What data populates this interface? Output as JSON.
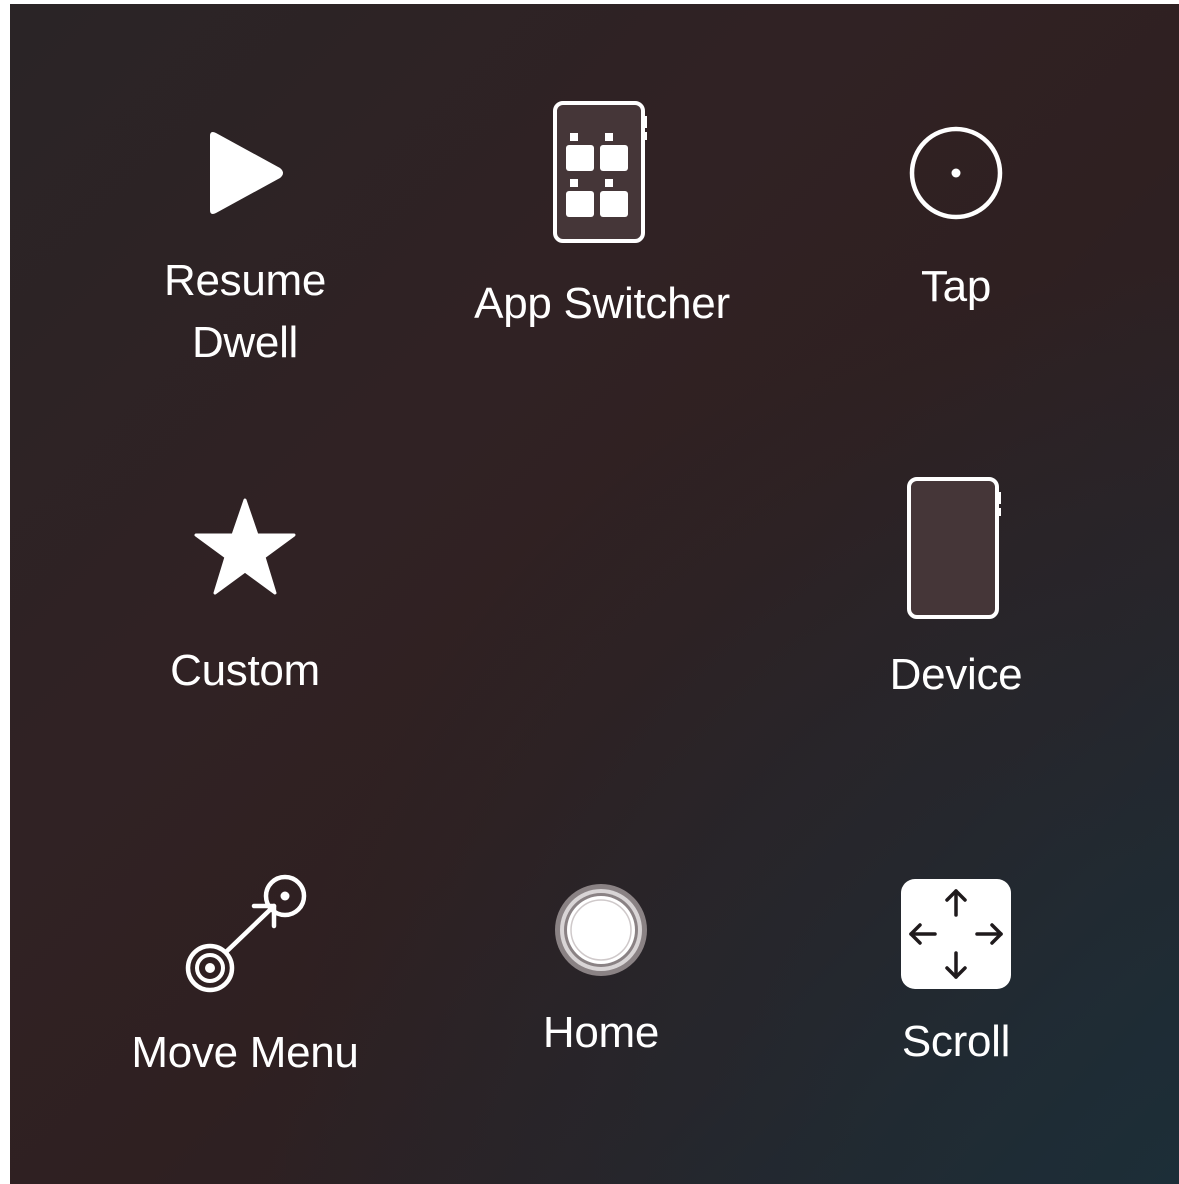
{
  "menu": {
    "items": [
      {
        "id": "resume-dwell",
        "label": "Resume\nDwell",
        "icon": "play-icon"
      },
      {
        "id": "app-switcher",
        "label": "App Switcher",
        "icon": "app-switcher-icon"
      },
      {
        "id": "tap",
        "label": "Tap",
        "icon": "tap-circle-icon"
      },
      {
        "id": "custom",
        "label": "Custom",
        "icon": "star-icon"
      },
      {
        "id": "device",
        "label": "Device",
        "icon": "device-icon"
      },
      {
        "id": "move-menu",
        "label": "Move Menu",
        "icon": "move-menu-icon"
      },
      {
        "id": "home",
        "label": "Home",
        "icon": "home-button-icon"
      },
      {
        "id": "scroll",
        "label": "Scroll",
        "icon": "scroll-arrows-icon"
      }
    ]
  },
  "colors": {
    "background": "#2f2224",
    "foreground": "#ffffff",
    "device_fill": "#453638"
  }
}
